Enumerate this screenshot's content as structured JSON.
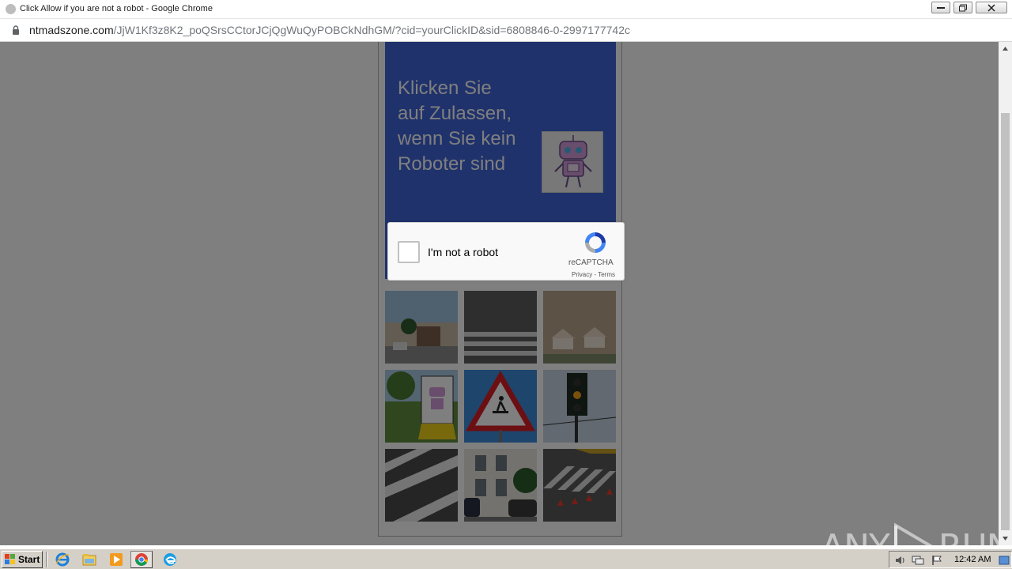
{
  "window": {
    "title": "Click Allow if you are not a robot - Google Chrome"
  },
  "address_bar": {
    "domain": "ntmadszone.com",
    "path": "/JjW1Kf3z8K2_poQSrsCCtorJCjQgWuQyPOBCkNdhGM/?cid=yourClickID&sid=6808846-0-2997177742c"
  },
  "page": {
    "headline": "Klicken Sie auf Zulassen, wenn Sie kein Roboter sind",
    "robot_image": "robot-illustration",
    "grid_images": [
      "house-street-tile",
      "road-crosswalk-tile",
      "houses-aerial-tile",
      "robot-sign-tile",
      "pedestrian-crossing-sign-tile",
      "traffic-light-tile",
      "crosswalk-stripes-tile",
      "building-cars-tile",
      "crosswalk-cones-tile"
    ]
  },
  "captcha": {
    "checkbox_label": "I'm not a robot",
    "brand": "reCAPTCHA",
    "privacy": "Privacy",
    "separator": " - ",
    "terms": "Terms"
  },
  "watermark": {
    "left": "ANY",
    "right": "RUN"
  },
  "taskbar": {
    "start_label": "Start",
    "clock": "12:42 AM",
    "icons": [
      "ie-icon",
      "explorer-icon",
      "media-player-icon",
      "chrome-icon",
      "edge-icon"
    ]
  }
}
